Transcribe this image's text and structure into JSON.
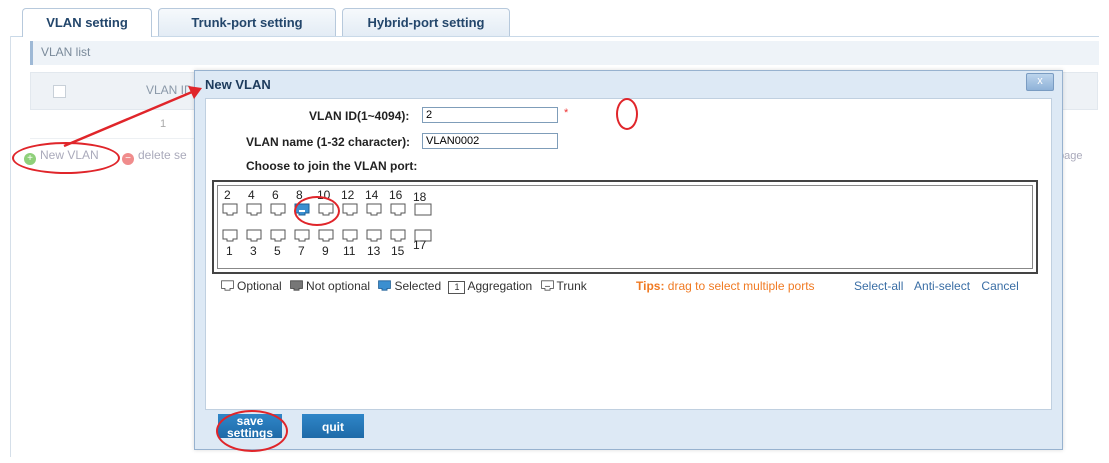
{
  "tabs": [
    {
      "label": "VLAN setting",
      "active": true
    },
    {
      "label": "Trunk-port setting",
      "active": false
    },
    {
      "label": "Hybrid-port setting",
      "active": false
    }
  ],
  "vlan_list": {
    "title": "VLAN list",
    "header_vlan_id": "VLAN ID",
    "row1_id": "1"
  },
  "actions": {
    "new_vlan": "New VLAN",
    "delete": "delete se",
    "page": "page"
  },
  "modal": {
    "title": "New VLAN",
    "close_label": "x",
    "vlan_id_label": "VLAN ID(1~4094):",
    "vlan_id_value": "2",
    "required_mark": "*",
    "vlan_name_label": "VLAN name (1-32 character):",
    "vlan_name_value": "VLAN0002",
    "choose_label": "Choose to join the VLAN port:",
    "ports_top": [
      "2",
      "4",
      "6",
      "8",
      "10",
      "12",
      "14",
      "16",
      "18"
    ],
    "ports_bottom": [
      "1",
      "3",
      "5",
      "7",
      "9",
      "11",
      "13",
      "15",
      "17"
    ],
    "selected_port": "8",
    "legend": {
      "optional": "Optional",
      "not_optional": "Not optional",
      "selected": "Selected",
      "aggregation": "Aggregation",
      "aggregation_icon_num": "1",
      "trunk": "Trunk"
    },
    "tips_label": "Tips:",
    "tips_text": "drag to select multiple ports",
    "select_all": "Select-all",
    "anti_select": "Anti-select",
    "cancel": "Cancel",
    "save_label_1": "save",
    "save_label_2": "settings",
    "quit_label": "quit"
  },
  "colors": {
    "accent": "#1e6aa8",
    "annotation": "#e0252a",
    "tips": "#f07a23"
  }
}
